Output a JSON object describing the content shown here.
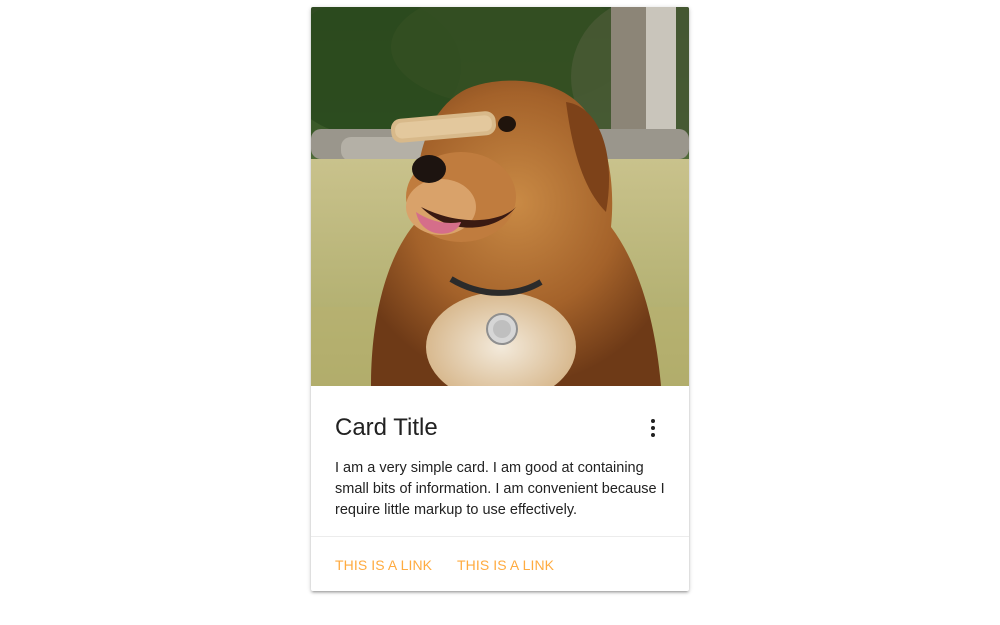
{
  "card": {
    "image_alt": "Dog balancing a biscuit on its nose",
    "title": "Card Title",
    "menu_icon": "more-vert-icon",
    "text": "I am a very simple card. I am good at containing small bits of information. I am convenient because I require little markup to use effectively.",
    "links": [
      {
        "label": "THIS IS A LINK"
      },
      {
        "label": "THIS IS A LINK"
      }
    ]
  },
  "colors": {
    "link": "#ffab40",
    "title": "#212121",
    "text": "#222222",
    "background": "#ffffff"
  }
}
